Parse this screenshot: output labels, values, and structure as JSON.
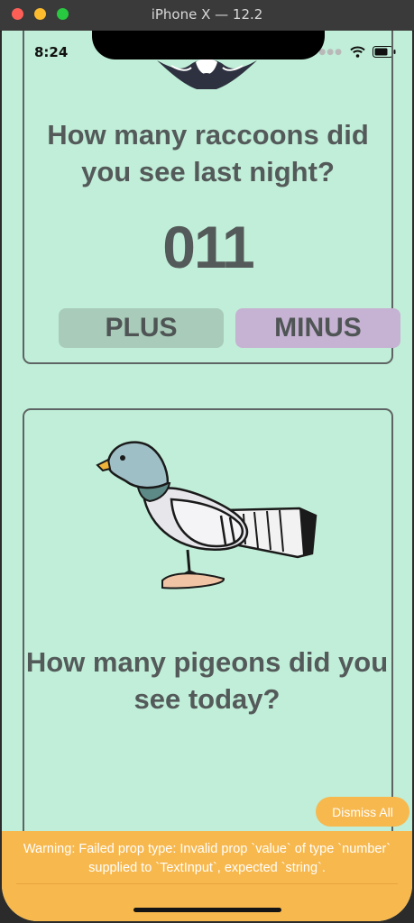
{
  "window": {
    "title": "iPhone X — 12.2"
  },
  "status_bar": {
    "time": "8:24"
  },
  "raccoon_card": {
    "question": "How many raccoons did you see last night?",
    "count": "011",
    "plus_label": "PLUS",
    "minus_label": "MINUS"
  },
  "pigeon_card": {
    "question": "How many pigeons did you see today?"
  },
  "yellowbox": {
    "dismiss_label": "Dismiss All",
    "warning": "Warning: Failed prop type: Invalid prop `value` of type `number` supplied to `TextInput`, expected `string`."
  },
  "colors": {
    "screen_bg": "#c0eed8",
    "plus_bg": "#a9cbb9",
    "minus_bg": "#c6b2d2",
    "text": "#545a5a",
    "warning_bg": "#f7b84e"
  },
  "icons": [
    "raccoon-icon",
    "pigeon-icon",
    "wifi-icon",
    "battery-icon",
    "signal-icon"
  ]
}
